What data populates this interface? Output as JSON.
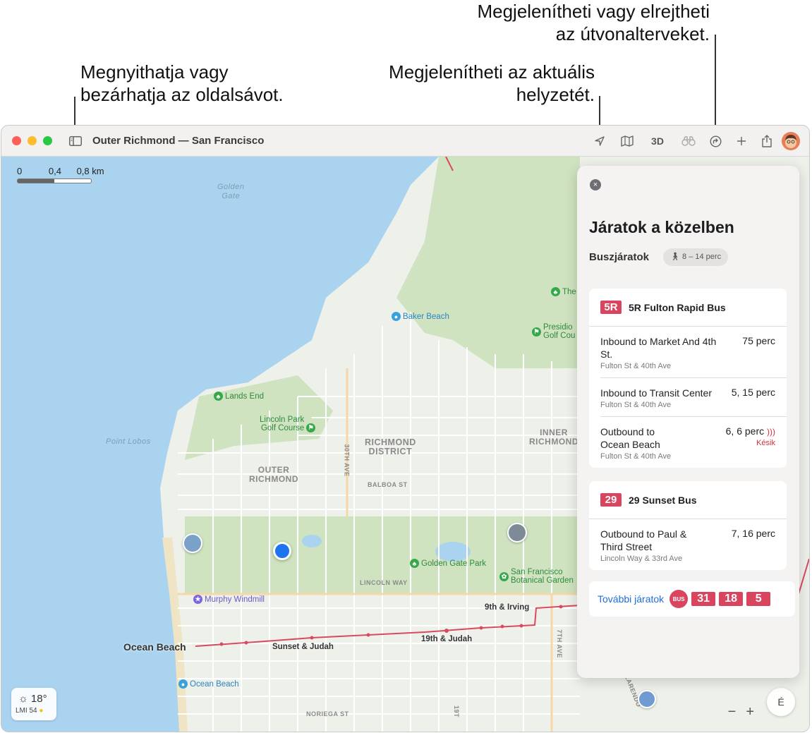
{
  "callouts": {
    "sidebar": [
      "Megnyithatja vagy",
      "bezárhatja az oldalsávot."
    ],
    "location": [
      "Megjelenítheti az aktuális",
      "helyzetét."
    ],
    "directions": [
      "Megjelenítheti vagy elrejtheti",
      "az útvonalterveket."
    ]
  },
  "window": {
    "title": "Outer Richmond — San Francisco",
    "toolbar": {
      "threed_label": "3D",
      "icons": [
        "sidebar-icon",
        "location-arrow-icon",
        "map-icon",
        "binoculars-icon",
        "directions-icon",
        "plus-icon",
        "share-icon"
      ]
    }
  },
  "map": {
    "scale": {
      "labels": [
        "0",
        "0,4",
        "0,8 km"
      ]
    },
    "labels": {
      "golden_gate": [
        "Golden",
        "Gate"
      ],
      "point_lobos": "Point Lobos",
      "richmond_district": [
        "RICHMOND",
        "DISTRICT"
      ],
      "outer_richmond": [
        "OUTER",
        "RICHMOND"
      ],
      "inner_richmond": [
        "INNER",
        "RICHMOND"
      ],
      "balboa_st": "BALBOA ST",
      "lincoln_way": "LINCOLN WAY",
      "noriega_st": "NORIEGA ST",
      "ave_30th": "30TH AVE",
      "ave_7th": "7TH AVE",
      "clarendon": "CLARENDO",
      "ave_19th": "19T"
    },
    "pois": {
      "baker_beach": "Baker Beach",
      "lands_end": "Lands End",
      "lincoln_park": [
        "Lincoln Park",
        "Golf Course"
      ],
      "golden_gate_park": "Golden Gate Park",
      "botanical": [
        "San Francisco",
        "Botanical Garden"
      ],
      "murphy_windmill": "Murphy Windmill",
      "ocean_beach_poi": "Ocean Beach",
      "presidio": [
        "Presidio",
        "Golf Cou"
      ],
      "the": "The"
    },
    "stops": {
      "ocean_beach": "Ocean Beach",
      "sunset_judah": "Sunset & Judah",
      "nineteenth_judah": "19th & Judah",
      "ninth_irving": "9th & Irving"
    },
    "weather": {
      "temp": "18°",
      "aqi": "LMI 54"
    },
    "compass": "É",
    "zoom": {
      "minus": "−",
      "plus": "+"
    }
  },
  "panel": {
    "close": "×",
    "title": "Járatok a közelben",
    "subtitle": "Buszjáratok",
    "walk": "8 – 14 perc",
    "routes": [
      {
        "badge": "5R",
        "name": "5R Fulton Rapid Bus",
        "trips": [
          {
            "dest": "Inbound to Market And 4th St.",
            "stop": "Fulton St & 40th Ave",
            "time": "75 perc",
            "late": ""
          },
          {
            "dest": "Inbound to Transit Center",
            "stop": "Fulton St & 40th Ave",
            "time": "5, 15 perc",
            "late": ""
          },
          {
            "dest": "Outbound to Ocean Beach",
            "stop": "Fulton St & 40th Ave",
            "time": "6, 6 perc",
            "late": "Késik"
          }
        ]
      },
      {
        "badge": "29",
        "name": "29 Sunset Bus",
        "trips": [
          {
            "dest": "Outbound to Paul & Third Street",
            "stop": "Lincoln Way & 33rd Ave",
            "time": "7, 16 perc",
            "late": ""
          }
        ]
      }
    ],
    "more": {
      "label": "További járatok",
      "bus_icon_text": "BUS",
      "badges": [
        "31",
        "18",
        "5"
      ]
    }
  },
  "colors": {
    "accent": "#1f6fd8",
    "route_badge": "#d9455e",
    "late": "#d6303a",
    "location": "#1e74ee",
    "water": "#aad3ef",
    "land": "#eef0ea",
    "park": "#cfe3c1"
  }
}
